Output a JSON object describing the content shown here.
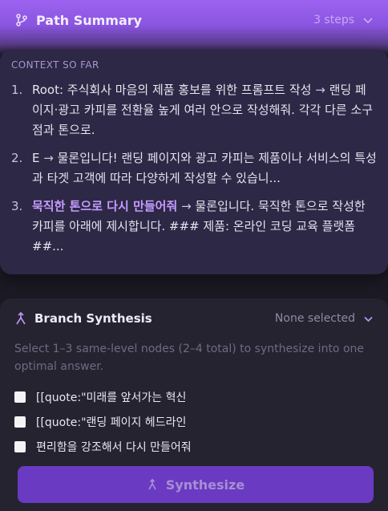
{
  "path_summary": {
    "title": "Path Summary",
    "steps": "3 steps",
    "context_label": "CONTEXT SO FAR",
    "items": [
      {
        "num": "1.",
        "key": "Root: 주식회사 마음의 제품 홍보를 위한 프롬프트 작성",
        "arrow": "→",
        "text": "랜딩 페이지·광고 카피를 전환율 높게 여러 안으로 작성해줘. 각각 다른 소구점과 톤으로."
      },
      {
        "num": "2.",
        "key": "E",
        "arrow": "→",
        "text": "물론입니다! 랜딩 페이지와 광고 카피는 제품이나 서비스의 특성과 타겟 고객에 따라 다양하게 작성할 수 있습니..."
      },
      {
        "num": "3.",
        "key": "묵직한 톤으로 다시 만들어줘",
        "arrow": "→",
        "text": "물론입니다. 묵직한 톤으로 작성한 카피를 아래에 제시합니다. ### 제품: 온라인 코딩 교육 플랫폼 ##..."
      }
    ]
  },
  "branch_synthesis": {
    "title": "Branch Synthesis",
    "selected": "None selected",
    "description": "Select 1–3 same-level nodes (2–4 total) to synthesize into one optimal answer.",
    "options": [
      {
        "label": "[[quote:\"미래를 앞서가는 혁신"
      },
      {
        "label": "[[quote:\"랜딩 페이지 헤드라인"
      },
      {
        "label": "편리함을 강조해서 다시 만들어줘"
      }
    ],
    "button_label": "Synthesize"
  },
  "colors": {
    "accent": "#9c63f0",
    "highlight": "#c79bff",
    "button": "#6a3bc2"
  }
}
